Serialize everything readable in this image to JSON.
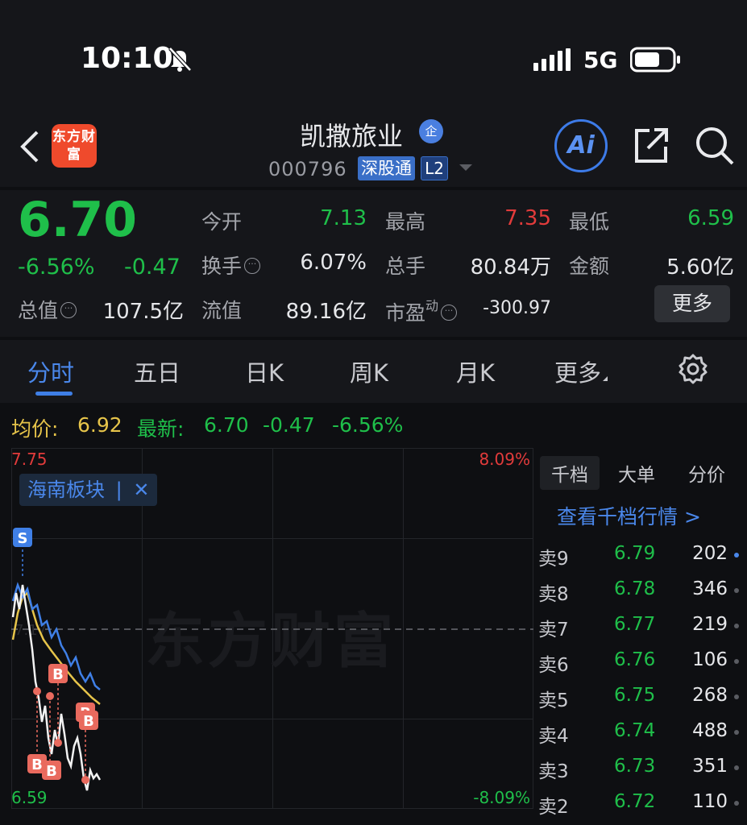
{
  "status": {
    "time": "10:10",
    "network": "5G"
  },
  "header": {
    "logo": "东方财富",
    "stock_name": "凯撒旅业",
    "corp_badge": "企",
    "code": "000796",
    "connect_badge": "深股通",
    "level_badge": "L2",
    "ai_label": "Ai"
  },
  "quote": {
    "price": "6.70",
    "pct": "-6.56%",
    "change": "-0.47",
    "open_label": "今开",
    "open": "7.13",
    "high_label": "最高",
    "high": "7.35",
    "low_label": "最低",
    "low": "6.59",
    "turnover_label": "换手",
    "turnover": "6.07%",
    "volume_label": "总手",
    "volume": "80.84万",
    "amount_label": "金额",
    "amount": "5.60亿",
    "mktcap_label": "总值",
    "mktcap": "107.5亿",
    "float_label": "流值",
    "float": "89.16亿",
    "pe_label": "市盈",
    "pe_sup": "动",
    "pe": "-300.97",
    "more_label": "更多"
  },
  "tabs": [
    {
      "label": "分时"
    },
    {
      "label": "五日"
    },
    {
      "label": "日K"
    },
    {
      "label": "周K"
    },
    {
      "label": "月K"
    },
    {
      "label": "更多"
    }
  ],
  "avg_row": {
    "avg_label": "均价:",
    "avg": "6.92",
    "latest_label": "最新:",
    "latest": "6.70",
    "chg": "-0.47",
    "pct": "-6.56%"
  },
  "chart": {
    "top_price": "7.75",
    "top_pct": "8.09%",
    "bottom_price": "6.59",
    "bottom_pct": "-8.09%",
    "watermark": "东方财富",
    "sector_chip": "海南板块",
    "chip_sep": "|",
    "chip_close": "✕",
    "mid_price": "7.17",
    "sell_marker": "S",
    "buy_marker": "B",
    "up_color": "#e23b3b",
    "down_color": "#1fbf4a"
  },
  "orderbook": {
    "tabs": [
      "千档",
      "大单",
      "分价"
    ],
    "link": "查看千档行情 >",
    "rows": [
      {
        "label": "卖9",
        "price": "6.79",
        "vol": "202"
      },
      {
        "label": "卖8",
        "price": "6.78",
        "vol": "346"
      },
      {
        "label": "卖7",
        "price": "6.77",
        "vol": "219"
      },
      {
        "label": "卖6",
        "price": "6.76",
        "vol": "106"
      },
      {
        "label": "卖5",
        "price": "6.75",
        "vol": "268"
      },
      {
        "label": "卖4",
        "price": "6.74",
        "vol": "488"
      },
      {
        "label": "卖3",
        "price": "6.73",
        "vol": "351"
      },
      {
        "label": "卖2",
        "price": "6.72",
        "vol": "110"
      }
    ]
  }
}
